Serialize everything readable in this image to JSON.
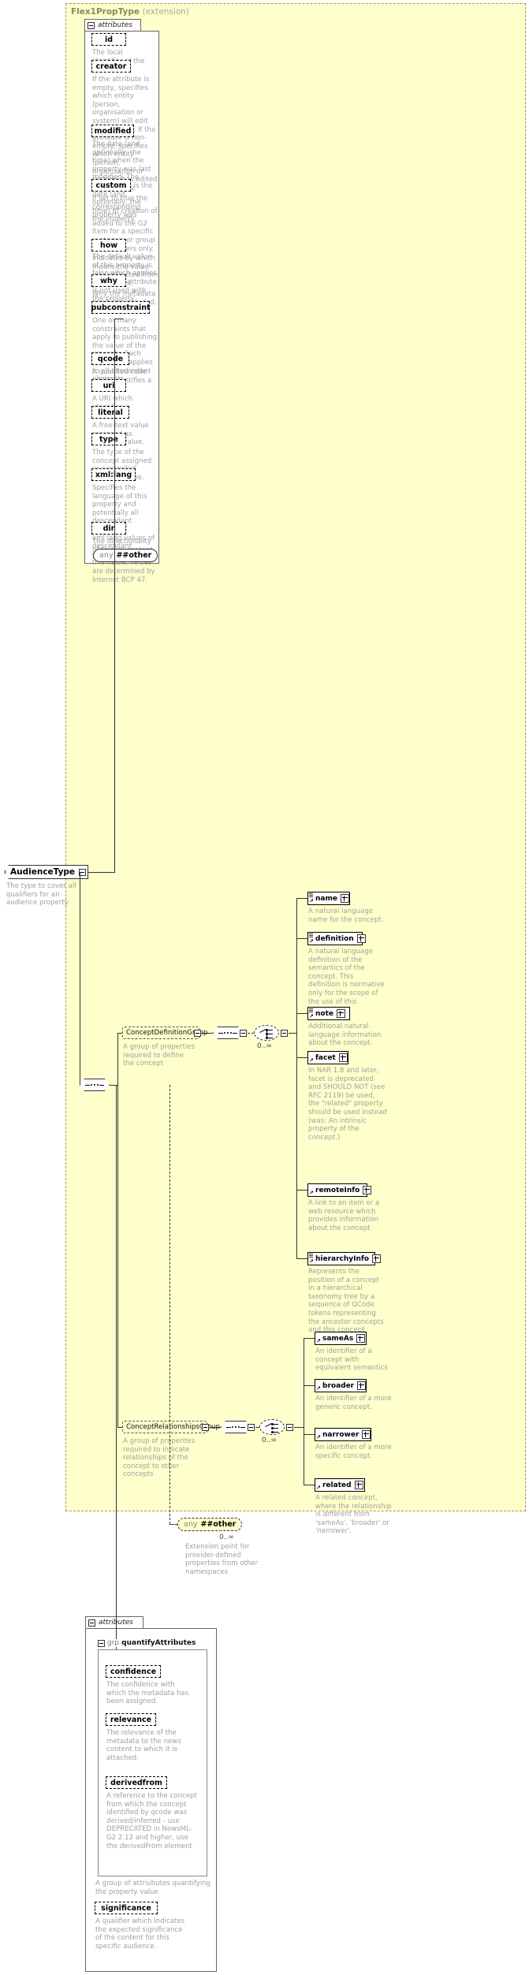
{
  "diagram": {
    "title": "Flex1PropType",
    "title_suffix": "(extension)",
    "attributes_label": "attributes",
    "group_word": "grp",
    "group_name": "quantifyAttributes",
    "any_word": "any",
    "any_namespace": "##other",
    "unbounded": "0..∞"
  },
  "type_node": {
    "name": "AudienceType",
    "annotation": "The type to cover all qualifiers for an audience property"
  },
  "flex_attributes": [
    {
      "name": "id",
      "annotation": "The local identifier of the property."
    },
    {
      "name": "creator",
      "annotation": "If the attribute is empty, specifies which entity (person, organisation or system) will edit the property. If the attribute is non-empty, specifies which entity (person, organisation or system) has edited the property."
    },
    {
      "name": "modified",
      "annotation": "The date (and, optionally, the time) when the property was last modified. The initial value is the date (and, optionally, the time) of creation of the property."
    },
    {
      "name": "custom",
      "annotation": "If set to true the corresponding property was added to the G2 Item for a specific customer or group of customers only. The default value of this property is false which applies when this attribute is not used with the property."
    },
    {
      "name": "how",
      "annotation": "Indicates by which means the value was extracted from the content."
    },
    {
      "name": "why",
      "annotation": "Why the metadata has been included."
    },
    {
      "name": "pubconstraint",
      "annotation": "One or many constraints that apply to publishing the value of the property. Each constraint applies to all descendant elements."
    },
    {
      "name": "qcode",
      "annotation": "A qualified code which identifies a concept."
    },
    {
      "name": "uri",
      "annotation": "A URI which identifies a concept."
    },
    {
      "name": "literal",
      "annotation": "A free-text value assigned as property value."
    },
    {
      "name": "type",
      "annotation": "The type of the concept assigned as controlled property value."
    },
    {
      "name": "xml:lang",
      "annotation": "Specifies the language of this property and potentially all descendant properties. xml:lang values of descendant properties override this value. Values are determined by Internet BCP 47."
    },
    {
      "name": "dir",
      "annotation": "The directionality of textual content."
    }
  ],
  "concept_definition_group": {
    "name": "ConceptDefinitionGroup",
    "annotation": "A group of properties required to define the concept",
    "cardinality": "0..∞",
    "elements": [
      {
        "name": "name",
        "annotation": "A natural language name for the concept."
      },
      {
        "name": "definition",
        "annotation": "A natural language definition of the semantics of the concept. This definition is normative only for the scope of the use of this concept."
      },
      {
        "name": "note",
        "annotation": "Additional natural language information about the concept."
      },
      {
        "name": "facet",
        "annotation": "In NAR 1.8 and later, facet is deprecated and SHOULD NOT (see RFC 2119) be used, the \"related\" property should be used instead (was: An intrinsic property of the concept.)"
      },
      {
        "name": "remoteInfo",
        "annotation": "A link to an item or a web resource which provides information about the concept"
      },
      {
        "name": "hierarchyInfo",
        "annotation": "Represents the position of a concept in a hierarchical taxonomy tree by a sequence of QCode tokens representing the ancestor concepts and this concept"
      }
    ]
  },
  "concept_relationships_group": {
    "name": "ConceptRelationshipsGroup",
    "annotation": "A group of properites required to indicate relationships of the concept to other concepts",
    "cardinality": "0..∞",
    "elements": [
      {
        "name": "sameAs",
        "annotation": "An identifier of a concept with equivalent semantics"
      },
      {
        "name": "broader",
        "annotation": "An identifier of a more generic concept."
      },
      {
        "name": "narrower",
        "annotation": "An identifier of a more specific concept."
      },
      {
        "name": "related",
        "annotation": "A related concept, where the relationship is different from 'sameAs', 'broader' or 'narrower'."
      }
    ]
  },
  "any_extension": {
    "word": "any",
    "namespace": "##other",
    "cardinality": "0..∞",
    "annotation": "Extension point for provider-defined properties from other namespaces"
  },
  "quantify_attributes": {
    "group_word": "grp",
    "group_name": "quantifyAttributes",
    "group_annotation": "A group of attriubutes quantifying the property value",
    "items": [
      {
        "name": "confidence",
        "annotation": "The confidence with which the metadata has been assigned."
      },
      {
        "name": "relevance",
        "annotation": "The relevance of the metadata to the news content to which it is attached."
      },
      {
        "name": "derivedfrom",
        "annotation": "A reference to the concept from which the concept identified by qcode was derived/inferred - use DEPRECATED in NewsML-G2 2.12 and higher, use the derivedFrom element"
      }
    ]
  },
  "bottom_attributes": {
    "label": "attributes",
    "items": [
      {
        "name": "significance",
        "annotation": "A qualifier which indicates the expected significance of the content for this specific audience."
      }
    ]
  },
  "colors": {
    "panel_fill": "#ffffcc",
    "panel_border": "#9a9a6a",
    "annotation_text": "#a0a0a0",
    "node_shadow": "#bbbbbb",
    "line": "#333333"
  }
}
